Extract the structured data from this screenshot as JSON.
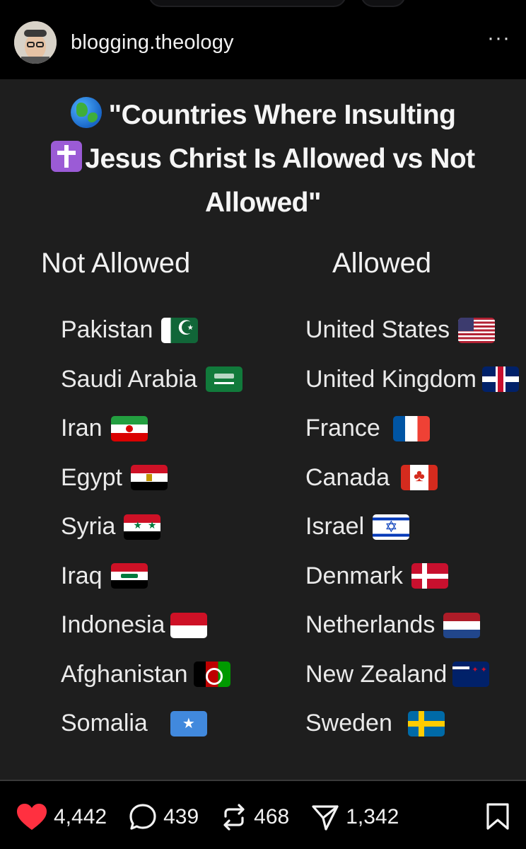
{
  "post": {
    "username": "blogging.theology",
    "more_label": "···",
    "title": {
      "line1": "\"Countries Where Insulting",
      "line2": "Jesus Christ Is Allowed vs Not",
      "line3": "Allowed\""
    },
    "columns": {
      "not_allowed_header": "Not Allowed",
      "allowed_header": "Allowed"
    },
    "not_allowed": [
      {
        "name": "Pakistan",
        "flag": "pk"
      },
      {
        "name": "Saudi Arabia",
        "flag": "sa"
      },
      {
        "name": "Iran",
        "flag": "ir"
      },
      {
        "name": "Egypt",
        "flag": "eg"
      },
      {
        "name": "Syria",
        "flag": "sy"
      },
      {
        "name": "Iraq",
        "flag": "iq"
      },
      {
        "name": "Indonesia",
        "flag": "id"
      },
      {
        "name": "Afghanistan",
        "flag": "af"
      },
      {
        "name": "Somalia",
        "flag": "so"
      }
    ],
    "allowed": [
      {
        "name": "United States",
        "flag": "us"
      },
      {
        "name": "United Kingdom",
        "flag": "uk"
      },
      {
        "name": "France",
        "flag": "fr"
      },
      {
        "name": "Canada",
        "flag": "ca"
      },
      {
        "name": "Israel",
        "flag": "il"
      },
      {
        "name": "Denmark",
        "flag": "dk"
      },
      {
        "name": "Netherlands",
        "flag": "nl"
      },
      {
        "name": "New Zealand",
        "flag": "nz"
      },
      {
        "name": "Sweden",
        "flag": "se"
      }
    ]
  },
  "actions": {
    "likes": "4,442",
    "comments": "439",
    "reposts": "468",
    "shares": "1,342"
  },
  "colors": {
    "like": "#ff3040",
    "background": "#000000",
    "post_background": "#1e1e1e"
  },
  "icons": {
    "like": "heart-icon",
    "comment": "comment-bubble-icon",
    "repost": "repost-icon",
    "share": "share-send-icon",
    "save": "bookmark-icon",
    "title_prefix": "globe-emoji-icon",
    "title_line2_prefix": "latin-cross-emoji-icon"
  }
}
